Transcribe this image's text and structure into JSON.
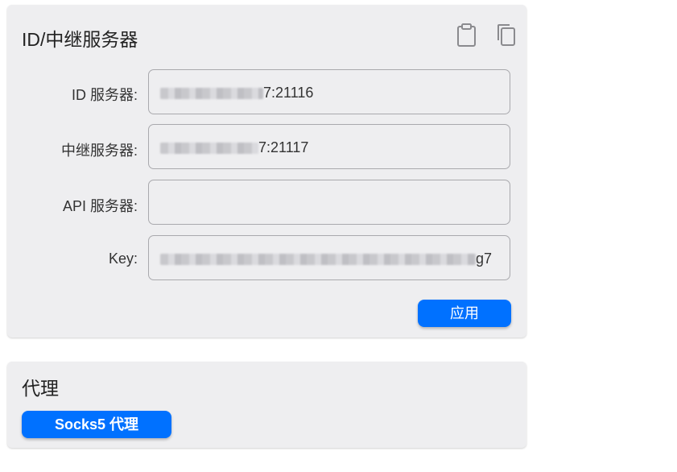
{
  "server_card": {
    "title": "ID/中继服务器",
    "icons": [
      "clipboard-icon",
      "copy-icon"
    ],
    "fields": {
      "id_server": {
        "label": "ID 服务器:",
        "value_suffix": "7:21116"
      },
      "relay_server": {
        "label": "中继服务器:",
        "value_suffix": "7:21117"
      },
      "api_server": {
        "label": "API 服务器:",
        "value": ""
      },
      "key": {
        "label": "Key:",
        "value_suffix": "g7"
      }
    },
    "apply_label": "应用"
  },
  "proxy_card": {
    "title": "代理",
    "socks_label": "Socks5 代理"
  },
  "colors": {
    "accent": "#0071ff",
    "card_bg": "#eeeef0",
    "border": "#a9a9ad"
  }
}
